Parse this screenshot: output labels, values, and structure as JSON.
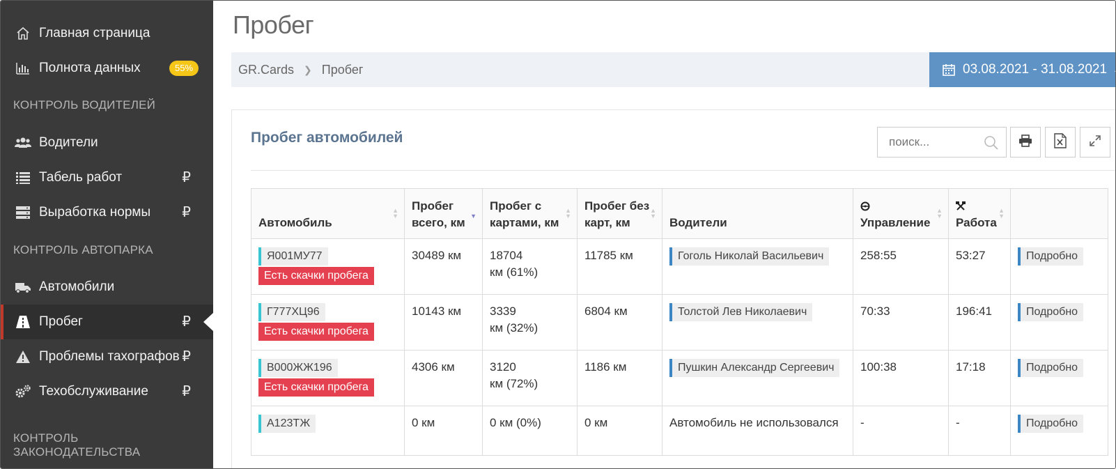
{
  "sidebar": {
    "items": [
      {
        "label": "Главная страница",
        "icon": "home-icon"
      },
      {
        "label": "Полнота данных",
        "icon": "bar-chart-icon",
        "badge": "55%"
      },
      {
        "label": "Водители",
        "icon": "users-icon"
      },
      {
        "label": "Табель работ",
        "icon": "list-icon",
        "suffix": "₽"
      },
      {
        "label": "Выработка нормы",
        "icon": "server-icon",
        "suffix": "₽"
      },
      {
        "label": "Автомобили",
        "icon": "truck-icon"
      },
      {
        "label": "Пробег",
        "icon": "road-icon",
        "suffix": "₽",
        "active": true
      },
      {
        "label": "Проблемы тахографов",
        "icon": "warning-icon",
        "suffix": "₽"
      },
      {
        "label": "Техобслуживание",
        "icon": "gears-icon",
        "suffix": "₽"
      }
    ],
    "sections": [
      "КОНТРОЛЬ ВОДИТЕЛЕЙ",
      "КОНТРОЛЬ АВТОПАРКА",
      "КОНТРОЛЬ ЗАКОНОДАТЕЛЬСТВА"
    ]
  },
  "page": {
    "title": "Пробег",
    "breadcrumb": [
      "GR.Cards",
      "Пробег"
    ],
    "date_range": "03.08.2021 - 31.08.2021"
  },
  "panel": {
    "title": "Пробег автомобилей",
    "search_placeholder": "поиск...",
    "table": {
      "headers": [
        "Автомобиль",
        "Пробег всего, км",
        "Пробег с картами, км",
        "Пробег без карт, км",
        "Водители",
        "Управление",
        "Работа"
      ],
      "rows": [
        {
          "plate": "Я001МУ77",
          "alert": "Есть скачки пробега",
          "total": "30489 км",
          "with_cards_1": "18704",
          "with_cards_2": "км (61%)",
          "without_cards": "11785 км",
          "driver": "Гоголь Николай Васильевич",
          "driving": "258:55",
          "work": "53:27",
          "action": "Подробно"
        },
        {
          "plate": "Г777ХЦ96",
          "alert": "Есть скачки пробега",
          "total": "10143 км",
          "with_cards_1": "3339",
          "with_cards_2": "км (32%)",
          "without_cards": "6804 км",
          "driver": "Толстой Лев Николаевич",
          "driving": "70:33",
          "work": "196:41",
          "action": "Подробно"
        },
        {
          "plate": "В000ЖЖ196",
          "alert": "Есть скачки пробега",
          "total": "4306 км",
          "with_cards_1": "3120",
          "with_cards_2": "км (72%)",
          "without_cards": "1186 км",
          "driver": "Пушкин Александр Сергеевич",
          "driving": "100:38",
          "work": "17:18",
          "action": "Подробно"
        },
        {
          "plate": "А123ТЖ",
          "alert": "",
          "total": "0 км",
          "with_cards_1": "0 км (0%)",
          "with_cards_2": "",
          "without_cards": "0 км",
          "driver_note": "Автомобиль не использовался",
          "driving": "-",
          "work": "-",
          "action": "Подробно"
        }
      ]
    }
  },
  "colors": {
    "sidebar_bg": "#3a3a3a",
    "accent_blue": "#5f93c5",
    "badge_yellow": "#f5c518",
    "alert_red": "#e4404f",
    "plate_marker": "#38c4d0"
  }
}
